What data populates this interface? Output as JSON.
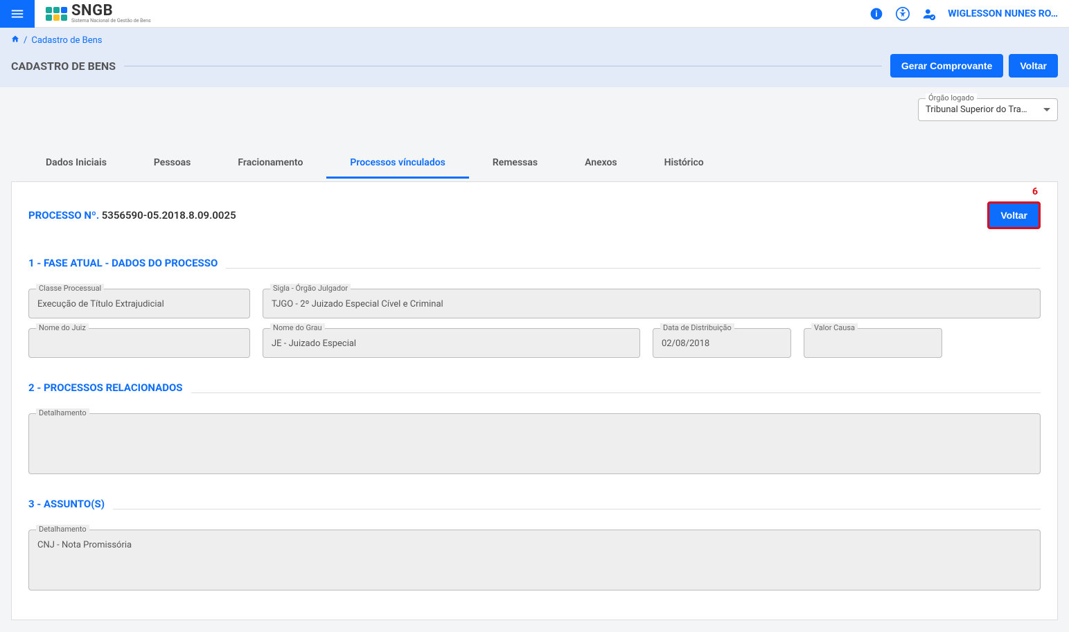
{
  "header": {
    "logo_text": "SNGB",
    "logo_sub": "Sistema Nacional de Gestão de Bens",
    "user_name": "WIGLESSON NUNES RO…"
  },
  "breadcrumb": {
    "crumb": "Cadastro de Bens"
  },
  "page": {
    "title": "CADASTRO DE BENS",
    "gerar_label": "Gerar Comprovante",
    "voltar_label": "Voltar"
  },
  "org": {
    "label": "Órgão logado",
    "value": "Tribunal Superior do Tra…"
  },
  "tabs": {
    "dados_iniciais": "Dados Iniciais",
    "pessoas": "Pessoas",
    "fracionamento": "Fracionamento",
    "processos_vinculados": "Processos vínculados",
    "remessas": "Remessas",
    "anexos": "Anexos",
    "historico": "Histórico"
  },
  "detail": {
    "processo_lbl": "PROCESSO Nº.",
    "processo_num": "5356590-05.2018.8.09.0025",
    "voltar_label": "Voltar",
    "anno_num": "6"
  },
  "sec1": {
    "title": "1 - FASE ATUAL - DADOS DO PROCESSO",
    "classe_lbl": "Classe Processual",
    "classe_val": "Execução de Título Extrajudicial",
    "sigla_lbl": "Sigla - Órgão Julgador",
    "sigla_val": "TJGO - 2º Juizado Especial Cível e Criminal",
    "juiz_lbl": "Nome do Juiz",
    "juiz_val": "",
    "grau_lbl": "Nome do Grau",
    "grau_val": "JE - Juizado Especial",
    "data_lbl": "Data de Distribuição",
    "data_val": "02/08/2018",
    "valor_lbl": "Valor Causa",
    "valor_val": ""
  },
  "sec2": {
    "title": "2 - PROCESSOS RELACIONADOS",
    "det_lbl": "Detalhamento",
    "det_val": ""
  },
  "sec3": {
    "title": "3 - ASSUNTO(S)",
    "det_lbl": "Detalhamento",
    "det_val": "CNJ - Nota Promissória"
  }
}
